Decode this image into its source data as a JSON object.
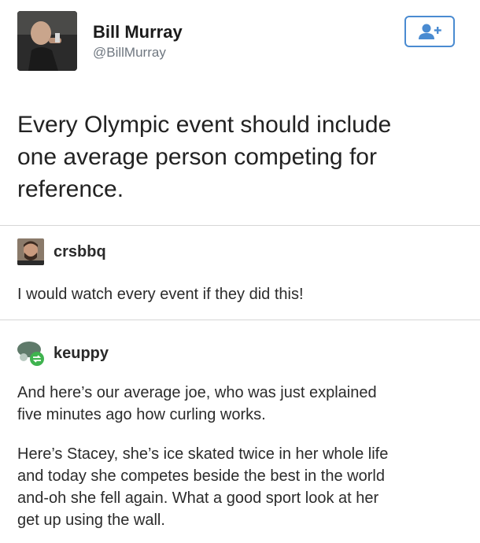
{
  "tweet": {
    "author_name": "Bill Murray",
    "author_handle": "@BillMurray",
    "follow_icon": "add-user-icon",
    "text_lines": [
      "Every Olympic event should include",
      "one average person competing for",
      "reference."
    ]
  },
  "replies": [
    {
      "username": "crsbbq",
      "paragraphs": [
        [
          "I would watch every event if they did this!"
        ]
      ]
    },
    {
      "username": "keuppy",
      "paragraphs": [
        [
          "And here’s our average joe, who was just explained",
          "five minutes ago how curling works."
        ],
        [
          "Here’s Stacey, she’s ice skated twice in her whole life",
          "and today she competes beside the best in the world",
          "and-oh she fell again. What a good sport look at her",
          "get up using the wall."
        ]
      ]
    }
  ],
  "colors": {
    "accent": "#4a8bd1",
    "handle": "#6f7780",
    "divider": "#d6d6d6",
    "reblog_badge": "#3fb34f"
  }
}
